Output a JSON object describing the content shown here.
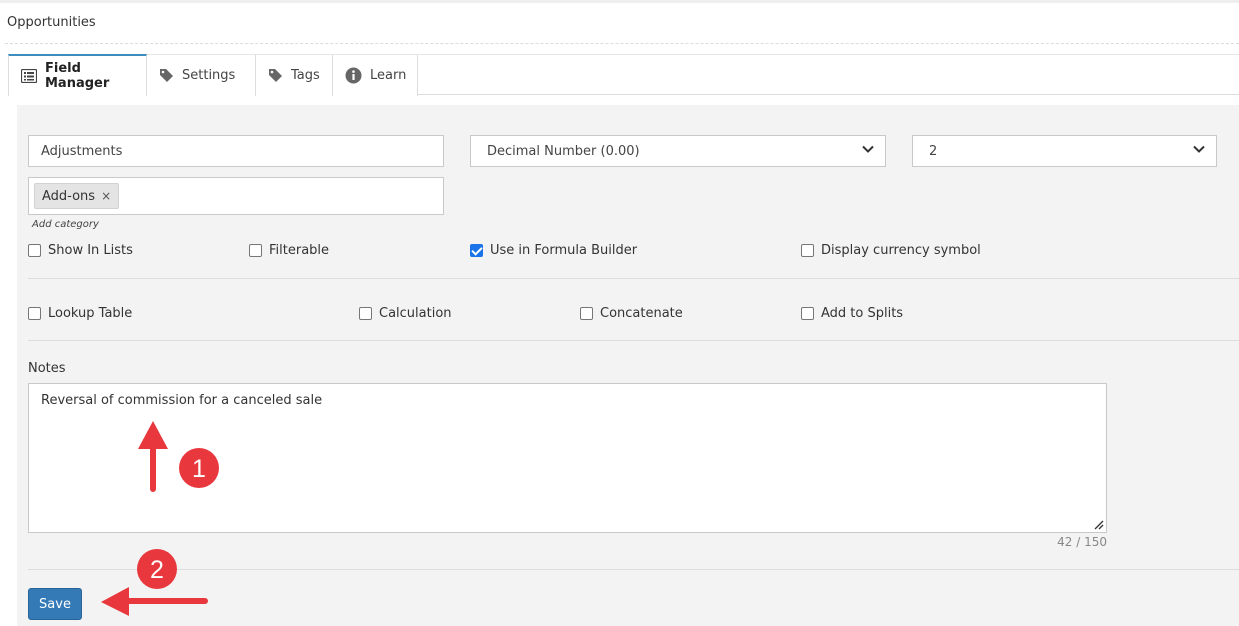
{
  "page": {
    "title": "Opportunities"
  },
  "tabs": [
    {
      "label": "Field Manager",
      "icon": "list-icon",
      "active": true
    },
    {
      "label": "Settings",
      "icon": "tag-icon",
      "active": false
    },
    {
      "label": "Tags",
      "icon": "tag-icon",
      "active": false
    },
    {
      "label": "Learn",
      "icon": "info-icon",
      "active": false
    }
  ],
  "form": {
    "field_name": "Adjustments",
    "field_type": "Decimal Number (0.00)",
    "decimals": "2",
    "category_chip": "Add-ons",
    "chip_remove": "×",
    "add_category_label": "Add category",
    "options_row1": [
      {
        "label": "Show In Lists",
        "checked": false
      },
      {
        "label": "Filterable",
        "checked": false
      },
      {
        "label": "Use in Formula Builder",
        "checked": true
      },
      {
        "label": "Display currency symbol",
        "checked": false
      }
    ],
    "options_row2": [
      {
        "label": "Lookup Table",
        "checked": false
      },
      {
        "label": "Calculation",
        "checked": false
      },
      {
        "label": "Concatenate",
        "checked": false
      },
      {
        "label": "Add to Splits",
        "checked": false
      }
    ],
    "notes_label": "Notes",
    "notes_value": "Reversal of commission for a canceled sale",
    "notes_counter": "42 / 150",
    "save_label": "Save"
  },
  "annotations": [
    {
      "number": "1"
    },
    {
      "number": "2"
    }
  ],
  "colors": {
    "accent": "#337ab7",
    "annotation": "#e8383d",
    "checkbox_checked": "#1a73e8",
    "panel_bg": "#f3f3f3"
  }
}
